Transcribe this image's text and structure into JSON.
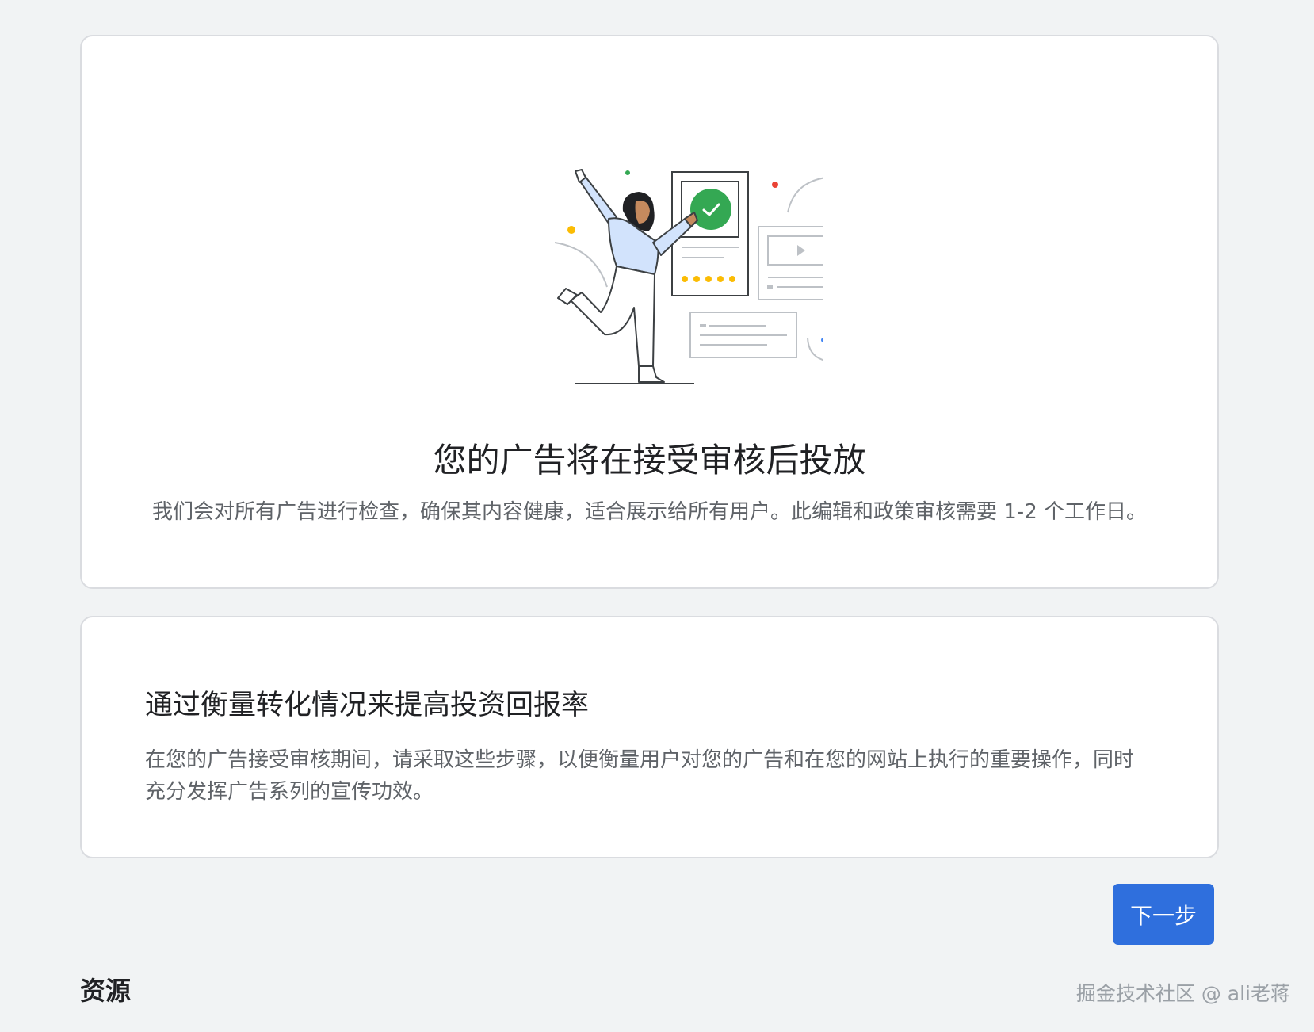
{
  "review_card": {
    "title": "您的广告将在接受审核后投放",
    "description": "我们会对所有广告进行检查，确保其内容健康，适合展示给所有用户。此编辑和政策审核需要 1-2 个工作日。"
  },
  "conversion_card": {
    "title": "通过衡量转化情况来提高投资回报率",
    "description": "在您的广告接受审核期间，请采取这些步骤，以便衡量用户对您的广告和在您的网站上执行的重要操作，同时充分发挥广告系列的宣传功效。"
  },
  "actions": {
    "next_label": "下一步"
  },
  "resources": {
    "heading": "资源"
  },
  "watermark": {
    "text": "掘金技术社区 @ ali老蒋"
  },
  "colors": {
    "page_background": "#f1f3f4",
    "primary_button": "#2f6fdd",
    "check_green": "#34a853",
    "star_yellow": "#fbbc04",
    "dot_red": "#ea4335",
    "dot_blue": "#4285f4",
    "sweater_blue": "#d2e3fc"
  },
  "icons": {
    "illustration": "ad-review-illustration",
    "check": "check-icon",
    "play": "play-icon"
  }
}
